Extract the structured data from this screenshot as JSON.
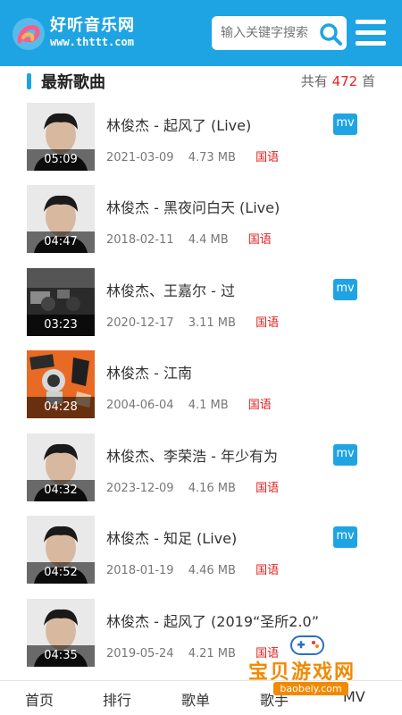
{
  "header": {
    "logo_name": "好听音乐网",
    "logo_url": "www.thttt.com",
    "search_placeholder": "输入关键字搜索",
    "search_icon": "search-icon",
    "menu_icon": "menu-icon"
  },
  "section": {
    "title": "最新歌曲",
    "total_prefix": "共有",
    "total_count": "472",
    "total_suffix": "首"
  },
  "songs": [
    {
      "title": "林俊杰 - 起风了 (Live)",
      "date": "2021-03-09",
      "size": "4.73 MB",
      "lang": "国语",
      "duration": "05:09",
      "has_mv": true,
      "mv_label": "mv"
    },
    {
      "title": "林俊杰 - 黑夜问白天 (Live)",
      "date": "2018-02-11",
      "size": "4.4 MB",
      "lang": "国语",
      "duration": "04:47",
      "has_mv": false
    },
    {
      "title": "林俊杰、王嘉尔 - 过",
      "date": "2020-12-17",
      "size": "3.11 MB",
      "lang": "国语",
      "duration": "03:23",
      "has_mv": true,
      "mv_label": "mv"
    },
    {
      "title": "林俊杰 - 江南",
      "date": "2004-06-04",
      "size": "4.1 MB",
      "lang": "国语",
      "duration": "04:28",
      "has_mv": false
    },
    {
      "title": "林俊杰、李荣浩 - 年少有为",
      "date": "2023-12-09",
      "size": "4.16 MB",
      "lang": "国语",
      "duration": "04:32",
      "has_mv": true,
      "mv_label": "mv"
    },
    {
      "title": "林俊杰 - 知足 (Live)",
      "date": "2018-01-19",
      "size": "4.46 MB",
      "lang": "国语",
      "duration": "04:52",
      "has_mv": true,
      "mv_label": "mv"
    },
    {
      "title": "林俊杰 - 起风了 (2019“圣所2.0”",
      "date": "2019-05-24",
      "size": "4.21 MB",
      "lang": "国语",
      "duration": "04:35",
      "has_mv": false
    }
  ],
  "tabbar": {
    "tabs": [
      "首页",
      "排行",
      "歌单",
      "歌手",
      "MV"
    ]
  },
  "watermark": {
    "text": "宝贝游戏网",
    "url": "baobeiy.com"
  },
  "colors": {
    "accent": "#1fa4e3",
    "lang": "#e02020",
    "count": "#e22222",
    "watermark": "#f08a00"
  }
}
